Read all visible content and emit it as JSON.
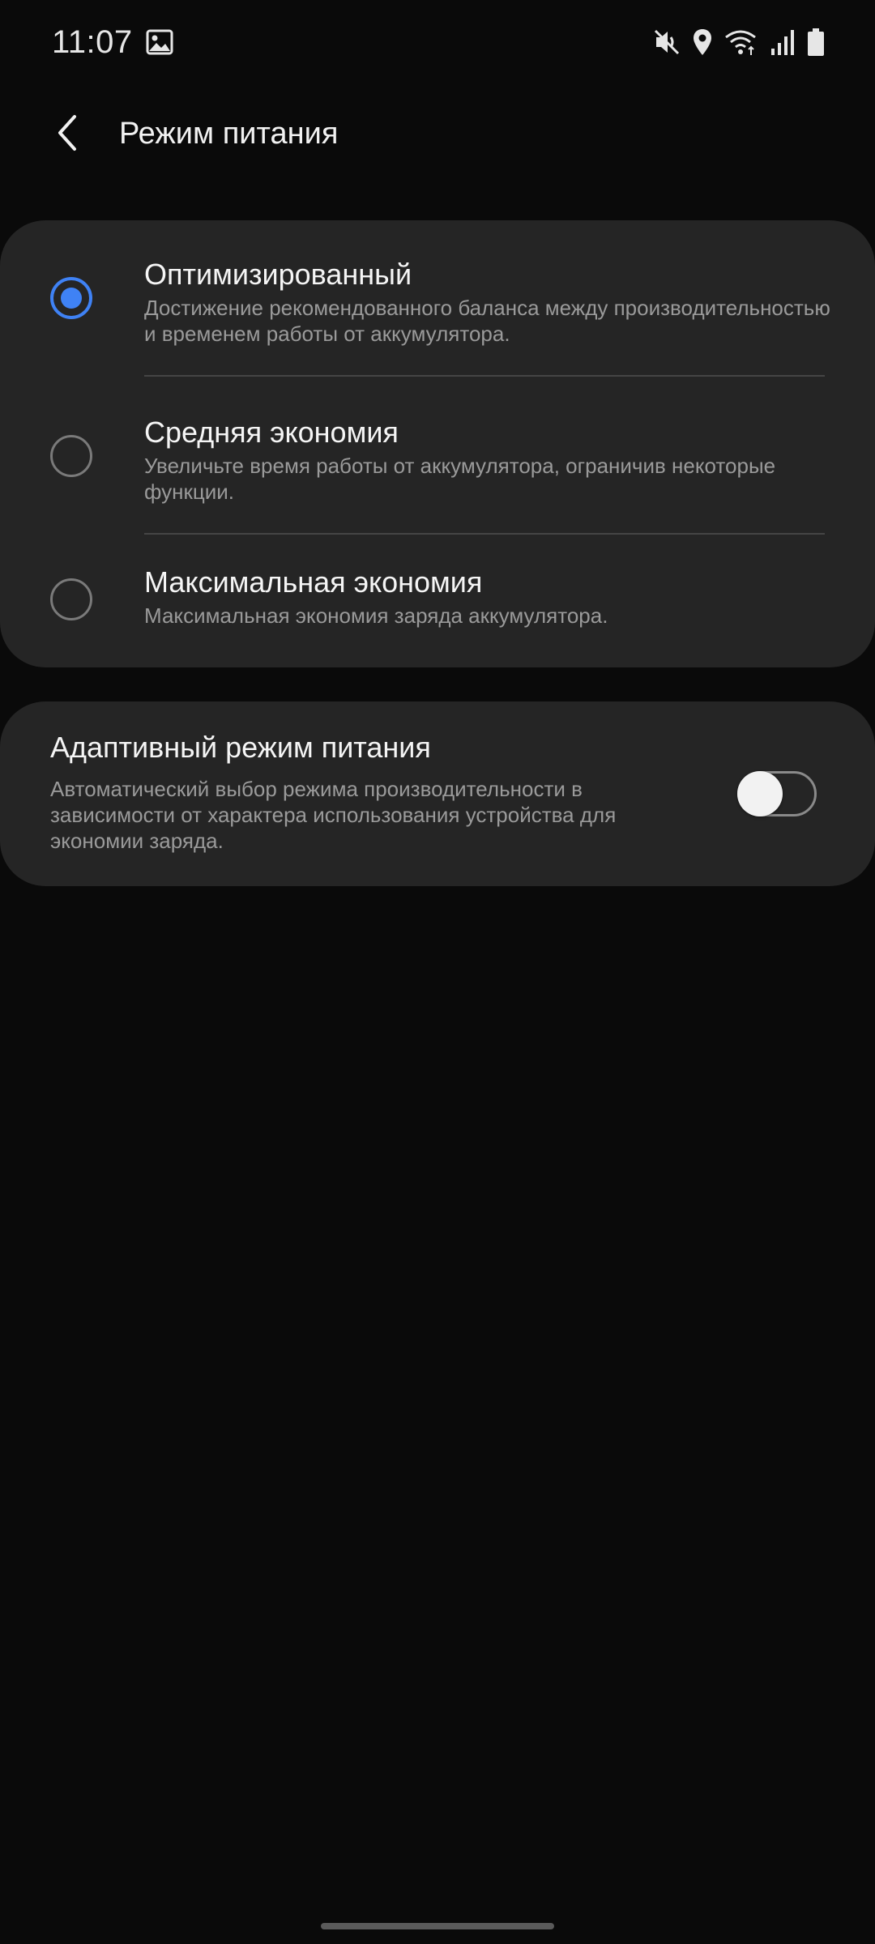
{
  "status_bar": {
    "time": "11:07",
    "icons": [
      "gallery-icon",
      "mute-icon",
      "location-icon",
      "wifi-icon",
      "signal-icon",
      "battery-icon"
    ]
  },
  "app_bar": {
    "title": "Режим питания"
  },
  "power_modes": [
    {
      "title": "Оптимизированный",
      "description": "Достижение рекомендованного баланса между производительностью и временем работы от аккумулятора.",
      "selected": true
    },
    {
      "title": "Средняя экономия",
      "description": "Увеличьте время работы от аккумулятора, ограничив некоторые функции.",
      "selected": false
    },
    {
      "title": "Максимальная экономия",
      "description": "Максимальная экономия заряда аккумулятора.",
      "selected": false
    }
  ],
  "adaptive": {
    "title": "Адаптивный режим питания",
    "description": "Автоматический выбор режима производительности в зависимости от характера использования устройства для экономии заряда.",
    "enabled": false
  },
  "colors": {
    "accent": "#3f82f5",
    "background": "#0a0a0a",
    "card": "#252525"
  }
}
